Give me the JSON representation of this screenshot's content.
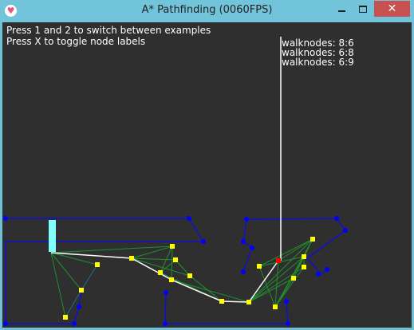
{
  "window": {
    "title": "A* Pathfinding (0060FPS)",
    "app_icon": "heart-icon",
    "controls": {
      "minimize_icon": "minimize-icon",
      "maximize_icon": "maximize-icon",
      "close_icon": "close-icon",
      "close_glyph": "✕"
    }
  },
  "instructions": [
    "Press 1 and 2 to switch between examples",
    "Press X to toggle node labels"
  ],
  "node_labels": [
    "walknodes: 8:6",
    "walknodes: 6:8",
    "walknodes: 6:9"
  ],
  "colors": {
    "background": "#2f2f2f",
    "walls": "#1010d0",
    "wall_nodes": "#0000ff",
    "walk_nodes": "#ffff00",
    "graph_edges": "#1f8f2f",
    "path": "#ffffff",
    "goal_node": "#ff0000",
    "start_marker": "#80ffff"
  }
}
